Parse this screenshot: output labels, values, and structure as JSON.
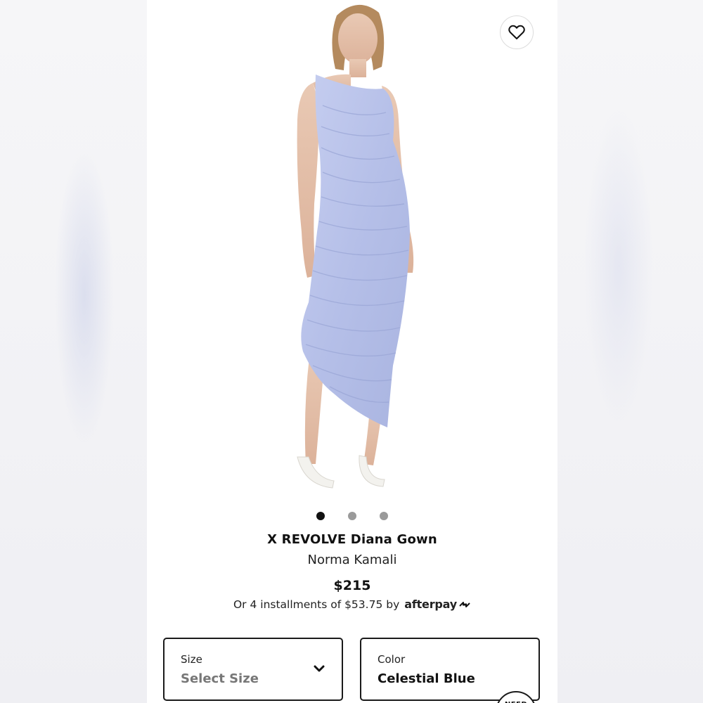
{
  "product": {
    "title": "X REVOLVE Diana Gown",
    "brand": "Norma Kamali",
    "price": "$215",
    "installments_prefix": "Or 4 installments of $53.75 by",
    "afterpay_label": "afterpay"
  },
  "gallery": {
    "image_count": 3,
    "active_index": 0
  },
  "size_select": {
    "label": "Size",
    "value": "Select Size"
  },
  "color_select": {
    "label": "Color",
    "value": "Celestial Blue"
  },
  "help_badge": {
    "label": "NEED"
  },
  "icons": {
    "favorite": "heart-icon",
    "dropdown": "chevron-down-icon",
    "afterpay": "afterpay-logo-icon"
  },
  "colors": {
    "dress": "#b9c3ea",
    "text": "#111111",
    "border": "#1a1a1a"
  }
}
